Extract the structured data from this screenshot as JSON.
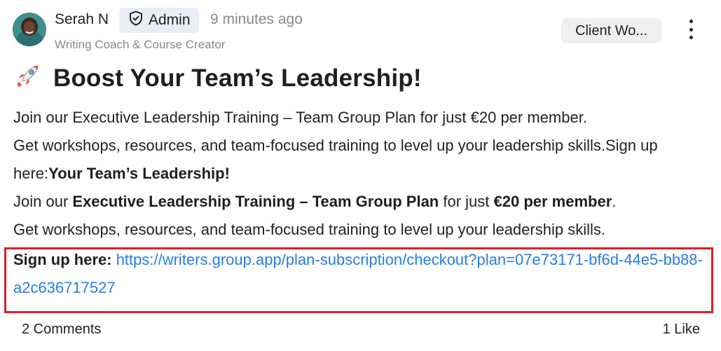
{
  "author": {
    "name": "Serah N",
    "role_badge": "Admin",
    "time_ago": "9 minutes ago",
    "subtitle": "Writing Coach & Course Creator",
    "avatar_icon": "person-photo"
  },
  "category_tag": "Client Wo...",
  "more_menu_icon": "vertical-ellipsis-icon",
  "post": {
    "title_emoji": "🚀",
    "title": "Boost Your Team’s Leadership!",
    "para1": "Join our Executive Leadership Training – Team Group Plan for just €20 per member.",
    "para2_start": "Get workshops, resources, and team-focused training to level up your leadership skills.Sign up here:",
    "para2_bold": "Your Team’s Leadership!",
    "para3_join": "Join our ",
    "para3_plan": "Executive Leadership Training – Team Group Plan",
    "para3_mid": " for just ",
    "para3_price": "€20 per member",
    "para3_end": ".",
    "para4": "Get workshops, resources, and team-focused training to level up your leadership skills.",
    "signup_label": "Sign up here:",
    "signup_link": "https://writers.group.app/plan-subscription/checkout?plan=07e73171-bf6d-44e5-bb88-a2c636717527"
  },
  "footer": {
    "comments": "2 Comments",
    "likes": "1 Like"
  },
  "colors": {
    "link": "#2a7de1",
    "highlight_border": "#d9202a",
    "badge_bg": "#e9edf7",
    "tag_bg": "#eeeff1"
  }
}
